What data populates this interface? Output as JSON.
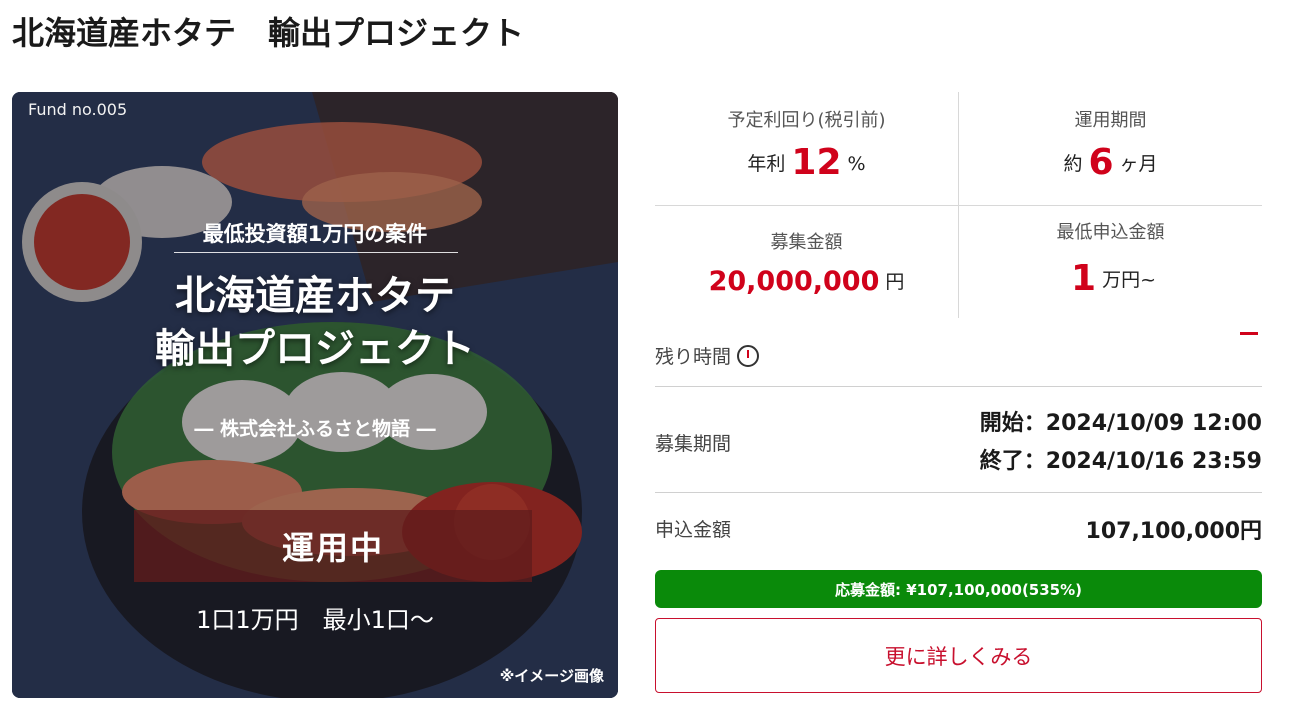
{
  "page": {
    "title": "北海道産ホタテ　輸出プロジェクト"
  },
  "hero": {
    "fund_no": "Fund no.005",
    "subtitle": "最低投資額1万円の案件",
    "title_line1": "北海道産ホタテ",
    "title_line2": "輸出プロジェクト",
    "company": "― 株式会社ふるさと物語 ―",
    "status": "運用中",
    "unit": "1口1万円　最小1口〜",
    "note": "※イメージ画像"
  },
  "stats": {
    "yield": {
      "label": "予定利回り(税引前)",
      "prefix": "年利",
      "value": "12",
      "suffix": "%"
    },
    "period": {
      "label": "運用期間",
      "prefix": "約",
      "value": "6",
      "suffix": "ヶ月"
    },
    "raise": {
      "label": "募集金額",
      "value": "20,000,000",
      "suffix": "円"
    },
    "min": {
      "label": "最低申込金額",
      "value": "1",
      "suffix": "万円~"
    }
  },
  "remaining": {
    "label": "残り時間",
    "value": "−"
  },
  "recruit": {
    "label": "募集期間",
    "start": "開始：2024/10/09 12:00",
    "end": "終了：2024/10/16 23:59"
  },
  "applied": {
    "label": "申込金額",
    "value": "107,100,000円"
  },
  "progress": {
    "text": "応募金額: ¥107,100,000(535%)",
    "percent": 535,
    "color": "#0a8a0a"
  },
  "actions": {
    "more_label": "更に詳しくみる"
  },
  "colors": {
    "accent": "#d0021b",
    "button": "#c8102e"
  }
}
